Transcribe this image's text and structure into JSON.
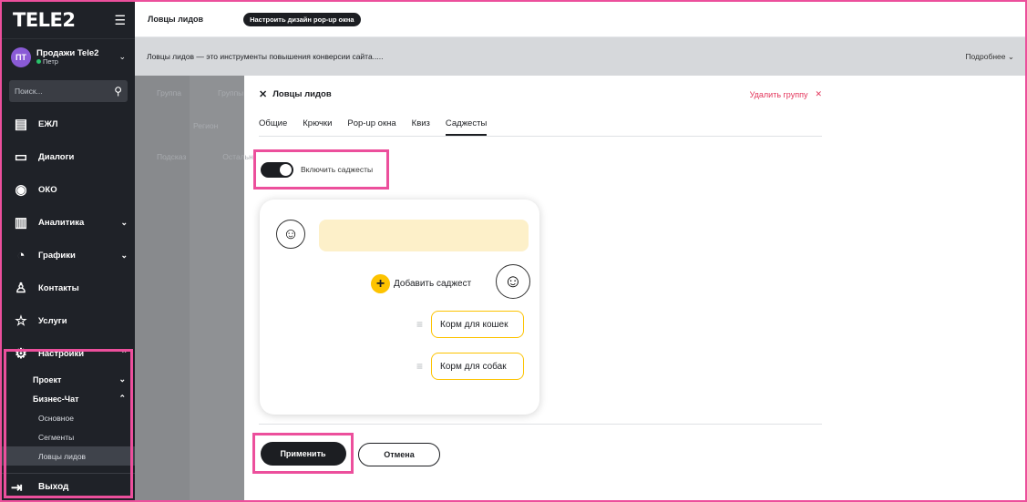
{
  "sidebar": {
    "logo": "TELE2",
    "menu_icon": "menu-lines-icon",
    "account": {
      "initials": "ПТ",
      "name": "Продажи Tele2",
      "user": "Петр",
      "avatar_color": "#8a5bd6",
      "status_color": "#29c46b"
    },
    "search_placeholder": "Поиск...",
    "items": [
      {
        "label": "ЕЖЛ",
        "icon": "document-icon",
        "expandable": false
      },
      {
        "label": "Диалоги",
        "icon": "chat-icon",
        "expandable": false
      },
      {
        "label": "ОКО",
        "icon": "eye-icon",
        "expandable": false
      },
      {
        "label": "Аналитика",
        "icon": "bar-chart-icon",
        "expandable": true
      },
      {
        "label": "Графики",
        "icon": "pie-chart-icon",
        "expandable": true
      },
      {
        "label": "Контакты",
        "icon": "user-icon",
        "expandable": false
      },
      {
        "label": "Услуги",
        "icon": "star-icon",
        "expandable": false
      },
      {
        "label": "Настройки",
        "icon": "gear-icon",
        "expandable": true,
        "expanded": true
      }
    ],
    "settings_sub": [
      {
        "label": "Проект",
        "expanded": false
      },
      {
        "label": "Бизнес-Чат",
        "expanded": true
      }
    ],
    "business_chat_sub": [
      "Основное",
      "Сегменты",
      "Ловцы лидов"
    ],
    "active_item": "Ловцы лидов",
    "logout": {
      "label": "Выход",
      "icon": "logout-icon"
    }
  },
  "topbar": {
    "title": "Ловцы лидов",
    "pill": "Настроить дизайн pop-up окна"
  },
  "infobar": {
    "text": "Ловцы лидов — это инструменты повышения конверсии сайта.....",
    "more": "Подробнее"
  },
  "background_list": {
    "header": [
      "Группа",
      "Группы"
    ],
    "rows": [
      [
        "",
        "Регион"
      ],
      [
        "Подсказ",
        "Остальн"
      ]
    ]
  },
  "panel": {
    "title": "Ловцы лидов",
    "delete_label": "Удалить группу",
    "tabs": [
      "Общие",
      "Крючки",
      "Pop-up окна",
      "Квиз",
      "Саджесты"
    ],
    "active_tab": "Саджесты",
    "toggle": {
      "label": "Включить саджесты",
      "on": true
    },
    "preview": {
      "add_label": "Добавить саджест",
      "suggestions": [
        "Корм для кошек",
        "Корм для собак"
      ],
      "bubble_color": "#fdf0c9",
      "accent_color": "#fdc300"
    },
    "apply_label": "Применить",
    "cancel_label": "Отмена"
  },
  "highlight_color": "#ec4f9c"
}
